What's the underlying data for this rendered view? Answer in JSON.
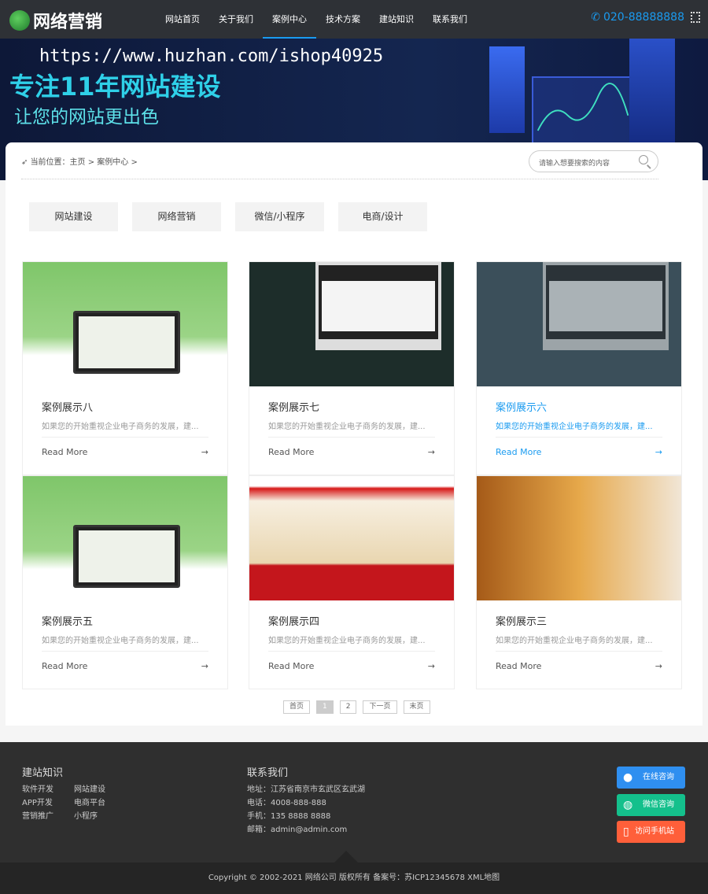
{
  "header": {
    "logo": "网络营销",
    "nav": [
      "网站首页",
      "关于我们",
      "案例中心",
      "技术方案",
      "建站知识",
      "联系我们"
    ],
    "phone": "020-88888888"
  },
  "banner": {
    "url": "https://www.huzhan.com/ishop40925",
    "title": "专注11年网站建设",
    "subtitle": "让您的网站更出色"
  },
  "breadcrumb": "当前位置：主页 > 案例中心 >",
  "search": {
    "placeholder": "请输入想要搜索的内容"
  },
  "filters": [
    "网站建设",
    "网络营销",
    "微信/小程序",
    "电商/设计"
  ],
  "cards": [
    {
      "title": "案例展示八",
      "desc": "如果您的开始重视企业电子商务的发展，建...",
      "more": "Read More"
    },
    {
      "title": "案例展示七",
      "desc": "如果您的开始重视企业电子商务的发展，建...",
      "more": "Read More"
    },
    {
      "title": "案例展示六",
      "desc": "如果您的开始重视企业电子商务的发展，建...",
      "more": "Read More"
    },
    {
      "title": "案例展示五",
      "desc": "如果您的开始重视企业电子商务的发展，建...",
      "more": "Read More"
    },
    {
      "title": "案例展示四",
      "desc": "如果您的开始重视企业电子商务的发展，建...",
      "more": "Read More"
    },
    {
      "title": "案例展示三",
      "desc": "如果您的开始重视企业电子商务的发展，建...",
      "more": "Read More"
    }
  ],
  "pager": [
    "首页",
    "1",
    "2",
    "下一页",
    "末页"
  ],
  "footer": {
    "col1_title": "建站知识",
    "links": [
      "软件开发",
      "网站建设",
      "APP开发",
      "电商平台",
      "营销推广",
      "小程序"
    ],
    "col2_title": "联系我们",
    "contact": [
      "地址：江苏省南京市玄武区玄武湖",
      "电话：4008-888-888",
      "手机：135 8888 8888",
      "邮箱：admin@admin.com"
    ],
    "buttons": [
      "在线咨询",
      "微信咨询",
      "访问手机站"
    ],
    "copyright": "Copyright © 2002-2021 网络公司 版权所有   备案号：苏ICP12345678  XML地图"
  },
  "colors": {
    "accent": "#1a9bf0",
    "qq": "#2f8ff0",
    "wechat": "#14c08c",
    "mobile": "#ff5f3a"
  }
}
